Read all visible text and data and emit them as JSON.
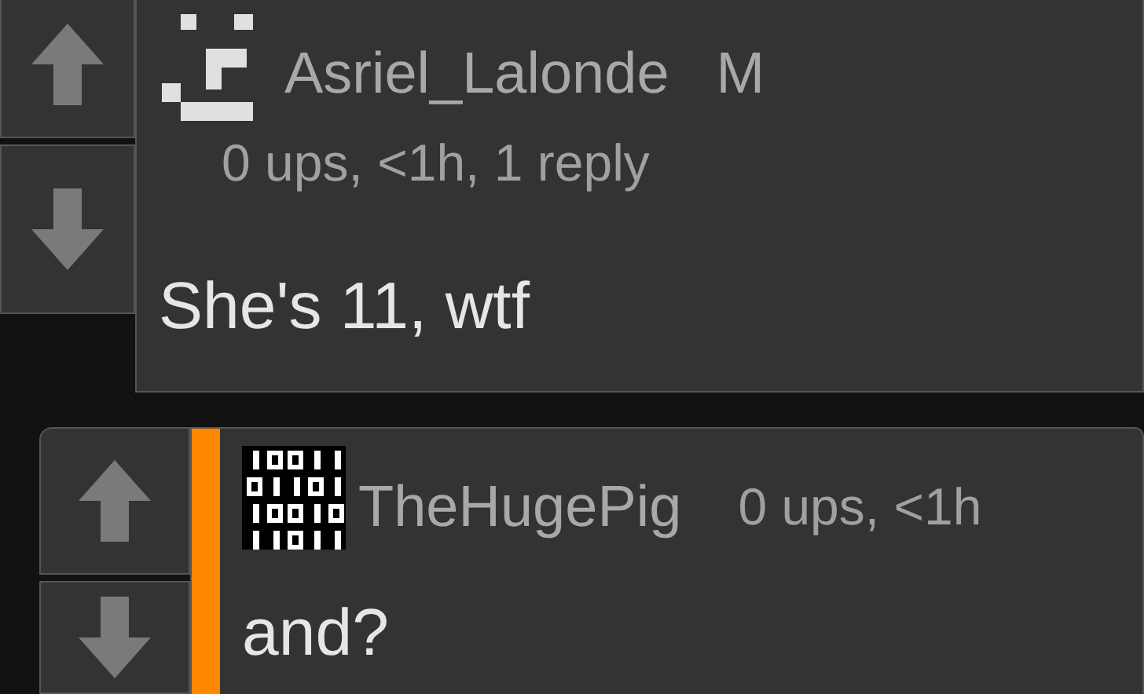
{
  "comments": [
    {
      "username": "Asriel_Lalonde",
      "gender": "M",
      "meta": "0 ups, <1h, 1 reply",
      "text": "She's 11, wtf",
      "highlighted": false,
      "avatar": {
        "kind": "face"
      }
    },
    {
      "username": "TheHugePig",
      "meta": "0 ups, <1h",
      "text": "and?",
      "highlighted": true,
      "avatar": {
        "kind": "grid"
      }
    }
  ]
}
